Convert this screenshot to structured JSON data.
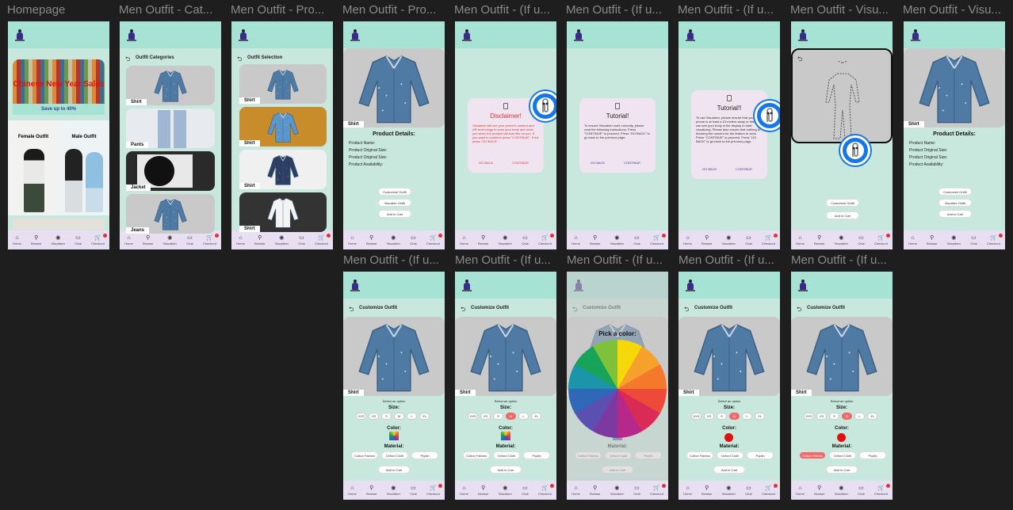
{
  "frames": [
    "Homepage",
    "Men Outfit - Cat...",
    "Men Outfit - Pro...",
    "Men Outfit - Pro...",
    "Men Outfit - (If u...",
    "Men Outfit - (If u...",
    "Men Outfit - (If u...",
    "Men Outfit - Visu...",
    "Men Outfit - Visu...",
    "Men Outfit - (If u...",
    "Men Outfit - (If u..."
  ],
  "nav": [
    "Home",
    "Browse",
    "Visualizer",
    "Chat",
    "Checkout"
  ],
  "home": {
    "banner_title": "Chinese New Year Sales",
    "save": "Save up to 40%",
    "female": "Female Outfit",
    "male": "Male Outfit"
  },
  "categories": {
    "title": "Outfit Categories",
    "items": [
      "Shirt",
      "Pants",
      "Jacket",
      "Jeans"
    ]
  },
  "selection": {
    "title": "Outfit Selection",
    "items": [
      "Shirt",
      "Shirt",
      "Shirt",
      "Shirt"
    ]
  },
  "product": {
    "tag": "Shirt",
    "details_title": "Product Details:",
    "fields": [
      "Product Name:",
      "Product Original Size:",
      "Product Original Size:",
      "Product Availability:"
    ],
    "customize": "Customize Outfit",
    "visualize": "Visualize Outfit",
    "cart": "Add to Cart"
  },
  "disclaimer": {
    "title": "Disclaimer!",
    "body": "Visualizer will use your phone's camera and AR technology to scan your body and show you when the product will look like on you. If you want to continue press \"CONTINUE\". If not press \"GO BACK\".",
    "back": "GO BACK",
    "cont": "CONTINUE"
  },
  "tutorial1": {
    "title": "Tutorial!",
    "body": "To ensure Visualizer work correctly, please read the following instructions. Press \"CONTINUE\" to proceed. Press \"GO BACK\" to go back to the previous page.",
    "back": "GO BACK",
    "cont": "CONTINUE"
  },
  "tutorial2": {
    "title": "Tutorial!!",
    "body": "To use Visualizer, please ensure that your phone is at least a 10 meters away or that you can see your body in the display to start visualizing. Please also ensure that nothing is blocking the camera for the feature to work. Press \"CONTINUE\" to proceed. Press \"GO BACK\" to go back to the previous page.",
    "back": "GO BACK",
    "cont": "CONTINUE"
  },
  "customize": {
    "title": "Customize Outfit",
    "select": "Select an option",
    "size": "Size:",
    "sizes": [
      "XXS",
      "XS",
      "S",
      "M",
      "L",
      "XL"
    ],
    "color": "Color:",
    "material": "Material:",
    "materials": [
      "Cotton Fabrics",
      "Oxford Cloth",
      "Poplin"
    ],
    "cart": "Add to Cart",
    "pick": "Pick a color:"
  },
  "wheel_colors": [
    "#f5d70a",
    "#f6a12b",
    "#f4792a",
    "#ee4a3a",
    "#d92b56",
    "#b6288a",
    "#7c3aa0",
    "#5b4fb1",
    "#2f68b6",
    "#1b95a9",
    "#18a35a",
    "#7fc23a"
  ]
}
